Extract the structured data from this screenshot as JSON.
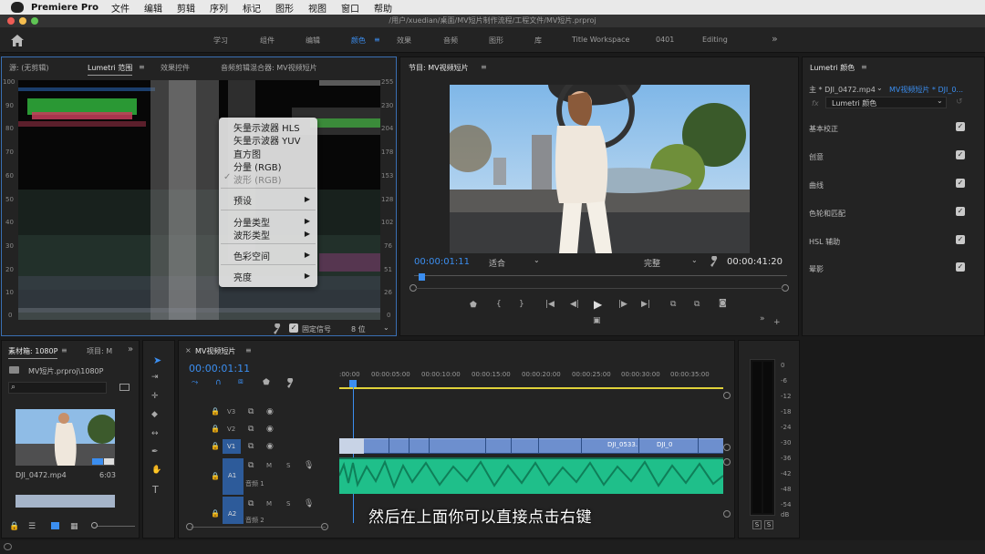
{
  "menubar": {
    "app": "Premiere Pro",
    "items": [
      "文件",
      "编辑",
      "剪辑",
      "序列",
      "标记",
      "图形",
      "视图",
      "窗口",
      "帮助"
    ]
  },
  "titlebar": {
    "path": "/用户/xuedian/桌面/MV短片制作流程/工程文件/MV短片.prproj"
  },
  "workspaces": [
    "学习",
    "组件",
    "编辑",
    "颜色",
    "效果",
    "音频",
    "图形",
    "库",
    "Title Workspace",
    "0401",
    "Editing"
  ],
  "workspace_more": "»",
  "source_panel": {
    "tabs": [
      "源: (无剪辑)",
      "Lumetri 范围",
      "效果控件",
      "音频剪辑混合器: MV视频短片"
    ],
    "menu_icon": "≡",
    "left_axis": [
      "100",
      "90",
      "80",
      "70",
      "60",
      "50",
      "40",
      "30",
      "20",
      "10",
      "0"
    ],
    "right_axis": [
      "255",
      "230",
      "204",
      "178",
      "153",
      "128",
      "102",
      "76",
      "51",
      "26",
      "0"
    ],
    "clamp_label": "固定信号",
    "bit_depth": "8 位"
  },
  "context_menu": {
    "items": [
      "矢量示波器 HLS",
      "矢量示波器 YUV",
      "直方图",
      "分量 (RGB)",
      "波形 (RGB)",
      "预设",
      "分量类型",
      "波形类型",
      "色彩空间",
      "亮度"
    ],
    "checked_mark": "✓"
  },
  "program_monitor": {
    "title": "节目: MV视频短片",
    "timecode": "00:00:01:11",
    "fit": "适合",
    "quality": "完整",
    "duration": "00:00:41:20"
  },
  "lumetri": {
    "title": "Lumetri 颜色",
    "master": "主 * DJI_0472.mp4",
    "sequence": "MV视频短片 * DJI_0...",
    "fx": "fx",
    "effect": "Lumetri 颜色",
    "sections": [
      "基本校正",
      "创意",
      "曲线",
      "色轮和匹配",
      "HSL 辅助",
      "晕影"
    ]
  },
  "project": {
    "tabs": [
      "素材箱: 1080P",
      "项目: M"
    ],
    "path": "MV短片.prproj\\1080P",
    "clip_name": "DJI_0472.mp4",
    "clip_duration": "6:03"
  },
  "timeline": {
    "title": "MV视频短片",
    "timecode": "00:00:01:11",
    "ruler": [
      ":00:00",
      "00:00:05:00",
      "00:00:10:00",
      "00:00:15:00",
      "00:00:20:00",
      "00:00:25:00",
      "00:00:30:00",
      "00:00:35:00"
    ],
    "tracks": [
      "V3",
      "V2",
      "V1",
      "A1",
      "A2"
    ],
    "a1_name": "音频 1",
    "a2_name": "音频 2",
    "clip_label1": "DJI_0533.",
    "clip_label2": "DJI_0",
    "m": "M",
    "s": "S"
  },
  "meter": {
    "ticks": [
      "0",
      "-6",
      "-12",
      "-18",
      "-24",
      "-30",
      "-36",
      "-42",
      "-48",
      "-54",
      "dB"
    ],
    "solo": "S"
  },
  "subtitle": "然后在上面你可以直接点击右键",
  "colors": {
    "accent": "#3b8ef0",
    "audio": "#1fbf8a",
    "video_clip": "#6d8fce",
    "panel": "#232323"
  }
}
